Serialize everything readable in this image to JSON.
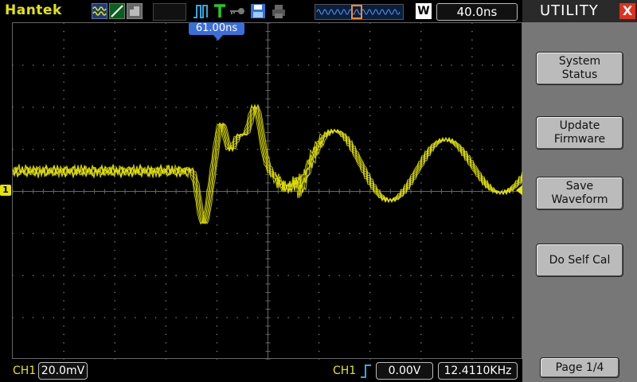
{
  "header": {
    "brand": "Hantek",
    "trigger_time": "40.0ns",
    "timebase_mode": "W",
    "trigger_position": "61.00ns"
  },
  "icons": [
    "waveform-icon",
    "ramp-icon",
    "grey-mode-icon",
    "pulse-icon",
    "trigger-t-icon",
    "key-icon",
    "save-disk-icon",
    "printer-icon"
  ],
  "channel": {
    "ground_marker": "1",
    "label": "CH1",
    "volts_div": "20.0mV"
  },
  "trigger": {
    "source": "CH1",
    "level": "0.00V",
    "frequency": "12.4110KHz"
  },
  "side_menu": {
    "title": "UTILITY",
    "close_glyph": "X",
    "buttons": [
      {
        "label": "System\nStatus"
      },
      {
        "label": "Update\nFirmware"
      },
      {
        "label": "Save\nWaveform"
      },
      {
        "label": "Do Self Cal"
      }
    ],
    "page": "Page 1/4"
  },
  "colors": {
    "trace": "#e6e600",
    "trigger_marker": "#3a6fd9",
    "close": "#e0301e"
  }
}
